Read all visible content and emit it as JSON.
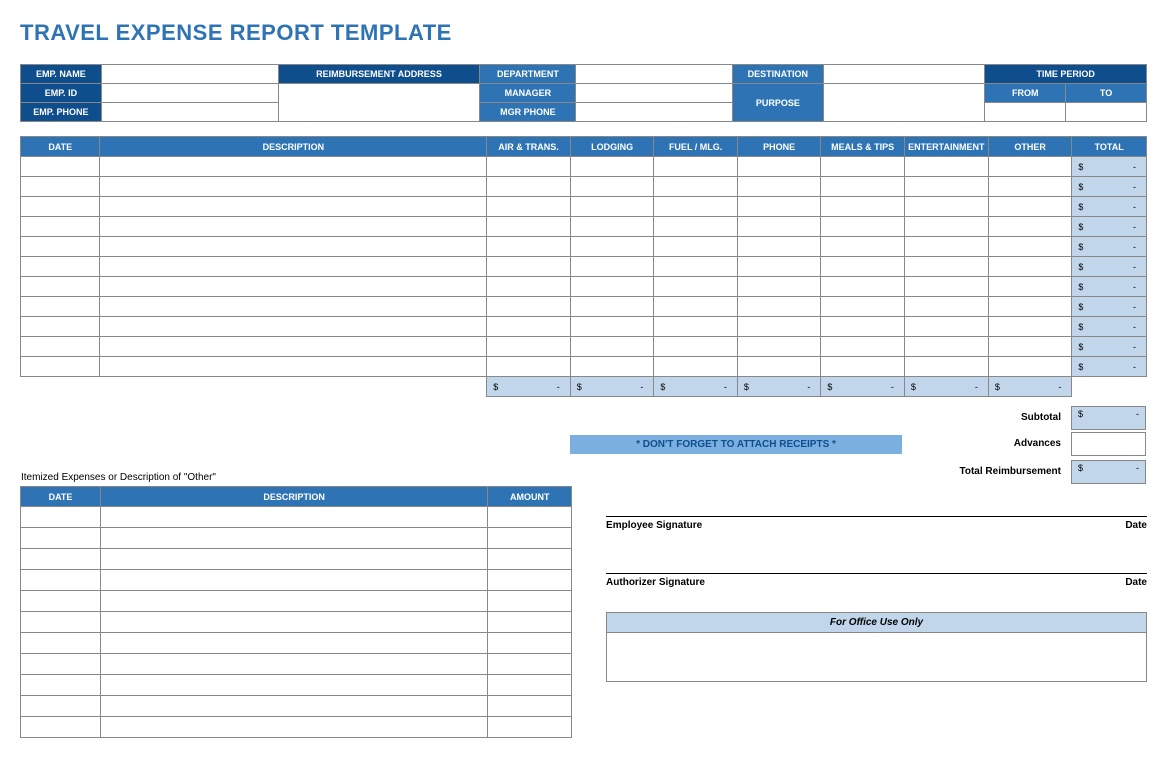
{
  "title": "TRAVEL EXPENSE REPORT TEMPLATE",
  "info": {
    "emp_name": "EMP. NAME",
    "emp_id": "EMP. ID",
    "emp_phone": "EMP. PHONE",
    "reimb_addr": "REIMBURSEMENT ADDRESS",
    "department": "DEPARTMENT",
    "manager": "MANAGER",
    "mgr_phone": "MGR PHONE",
    "destination": "DESTINATION",
    "purpose": "PURPOSE",
    "time_period": "TIME PERIOD",
    "from": "FROM",
    "to": "TO"
  },
  "exp_headers": {
    "date": "DATE",
    "description": "DESCRIPTION",
    "air": "AIR & TRANS.",
    "lodging": "LODGING",
    "fuel": "FUEL / MLG.",
    "phone": "PHONE",
    "meals": "MEALS & TIPS",
    "entertainment": "ENTERTAINMENT",
    "other": "OTHER",
    "total": "TOTAL"
  },
  "row_total": {
    "currency": "$",
    "dash": "-"
  },
  "summary": {
    "subtotal": "Subtotal",
    "advances": "Advances",
    "total_reimb": "Total Reimbursement",
    "reminder": "*  DON'T FORGET TO ATTACH RECEIPTS  *"
  },
  "itemized": {
    "caption": "Itemized Expenses or Description of \"Other\"",
    "date": "DATE",
    "description": "DESCRIPTION",
    "amount": "AMOUNT"
  },
  "sig": {
    "employee": "Employee Signature",
    "authorizer": "Authorizer Signature",
    "date": "Date",
    "office": "For Office Use Only"
  }
}
